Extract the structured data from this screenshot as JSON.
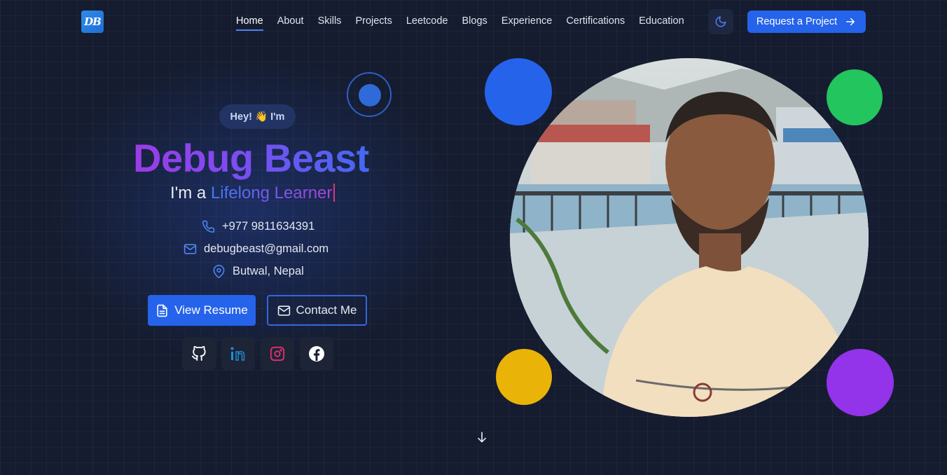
{
  "header": {
    "logo_text": "DB",
    "nav": [
      {
        "label": "Home",
        "active": true
      },
      {
        "label": "About"
      },
      {
        "label": "Skills"
      },
      {
        "label": "Projects"
      },
      {
        "label": "Leetcode"
      },
      {
        "label": "Blogs"
      },
      {
        "label": "Experience"
      },
      {
        "label": "Certifications"
      },
      {
        "label": "Education"
      }
    ],
    "theme_toggle_icon": "moon-icon",
    "cta_label": "Request a Project"
  },
  "hero": {
    "greeting": "Hey! 👋 I'm",
    "name": "Debug Beast",
    "role_prefix": "I'm a ",
    "role_typed": "Lifelong Learner",
    "phone": "+977 9811634391",
    "email": "debugbeast@gmail.com",
    "location": "Butwal, Nepal",
    "resume_label": "View Resume",
    "contact_label": "Contact Me",
    "socials": [
      "github-icon",
      "linkedin-icon",
      "instagram-icon",
      "facebook-icon"
    ]
  },
  "colors": {
    "accent": "#2563eb",
    "circle_blue": "#2563eb",
    "circle_green": "#22c55e",
    "circle_yellow": "#eab308",
    "circle_purple": "#9333ea"
  }
}
